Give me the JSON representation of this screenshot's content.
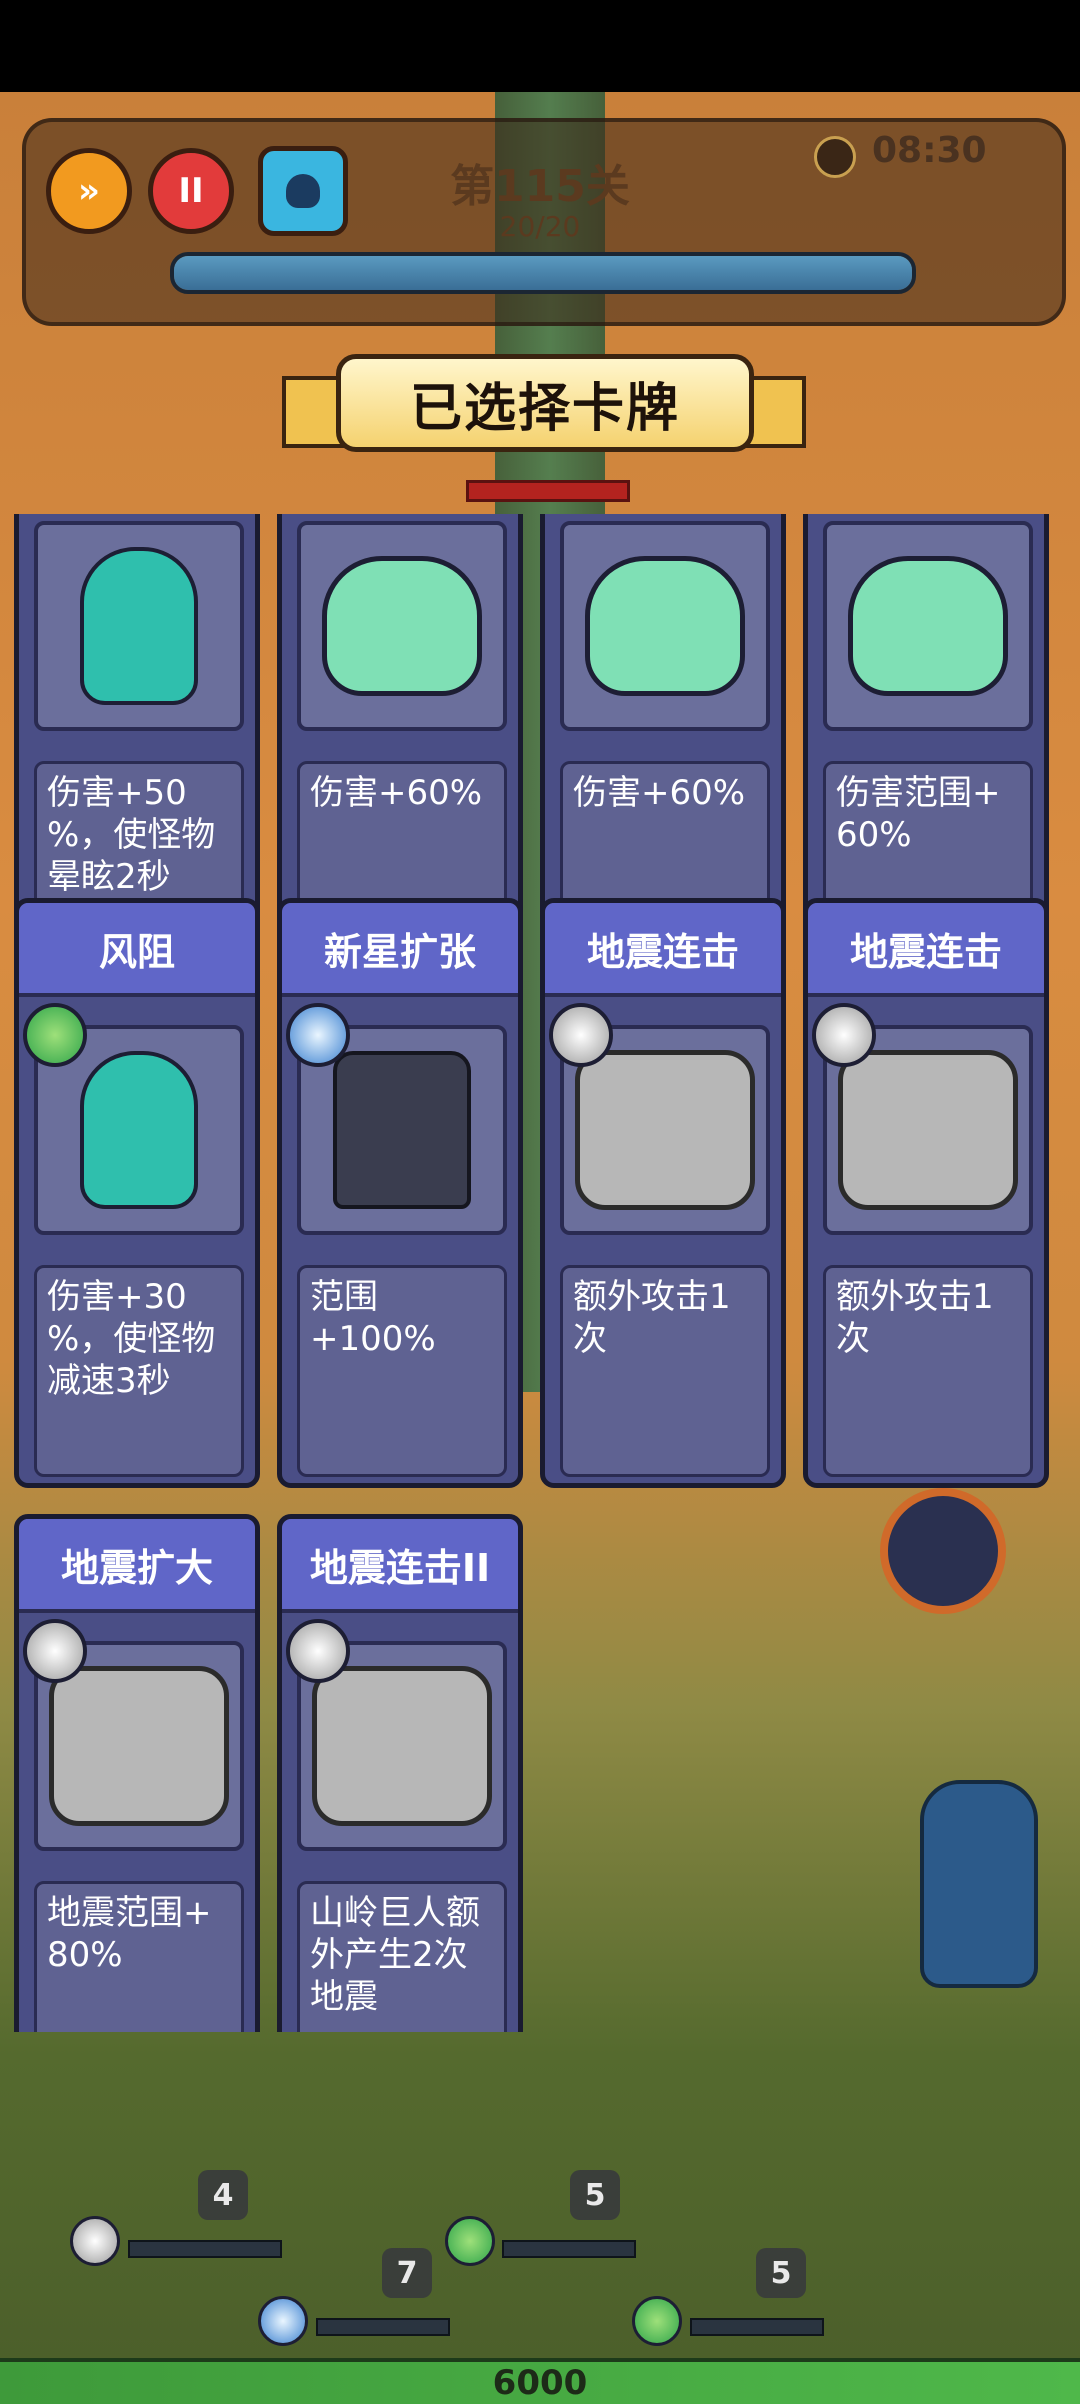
{
  "hud": {
    "level": "第115关",
    "wave": "20/20",
    "timer": "08:30",
    "wave_progress_fraction": 1.0
  },
  "banner": {
    "title": "已选择卡牌"
  },
  "cards": [
    {
      "title": "",
      "desc": "伤害+50%，使怪物晕眩2秒",
      "desc_lines": [
        "伤害+50",
        "%，使怪物",
        "晕眩2秒"
      ],
      "badge": "",
      "char": "ghost"
    },
    {
      "title": "",
      "desc_lines": [
        "伤害+60%"
      ],
      "badge": "",
      "char": "bird"
    },
    {
      "title": "",
      "desc_lines": [
        "伤害+60%"
      ],
      "badge": "",
      "char": "bird"
    },
    {
      "title": "",
      "desc_lines": [
        "伤害范围+",
        "60%"
      ],
      "badge": "",
      "char": "bird"
    },
    {
      "title": "风阻",
      "desc_lines": [
        "伤害+30",
        "%，使怪物",
        "减速3秒"
      ],
      "badge": "wind",
      "char": "ghost"
    },
    {
      "title": "新星扩张",
      "desc_lines": [
        "范围+100%"
      ],
      "badge": "ice",
      "char": "knight"
    },
    {
      "title": "地震连击",
      "desc_lines": [
        "额外攻击1",
        "次"
      ],
      "badge": "rock",
      "char": "golem"
    },
    {
      "title": "地震连击",
      "desc_lines": [
        "额外攻击1",
        "次"
      ],
      "badge": "rock",
      "char": "golem"
    },
    {
      "title": "地震扩大",
      "desc_lines": [
        "地震范围+",
        "80%"
      ],
      "badge": "rock",
      "char": "golem"
    },
    {
      "title": "地震连击II",
      "desc_lines": [
        "山岭巨人额",
        "外产生2次",
        "地震"
      ],
      "badge": "rock",
      "char": "golem"
    }
  ],
  "units": {
    "golem_level": "4",
    "ghost_level": "5",
    "knight_level": "7",
    "bird_level": "5"
  },
  "base_hp": "6000",
  "icons": {
    "speed": "fast-forward-icon",
    "pause": "pause-icon",
    "skull": "skull-icon",
    "timer": "clock-icon"
  },
  "colors": {
    "card_header": "#6066c8",
    "card_body": "#4a4e86",
    "banner": "#f5d26f"
  }
}
